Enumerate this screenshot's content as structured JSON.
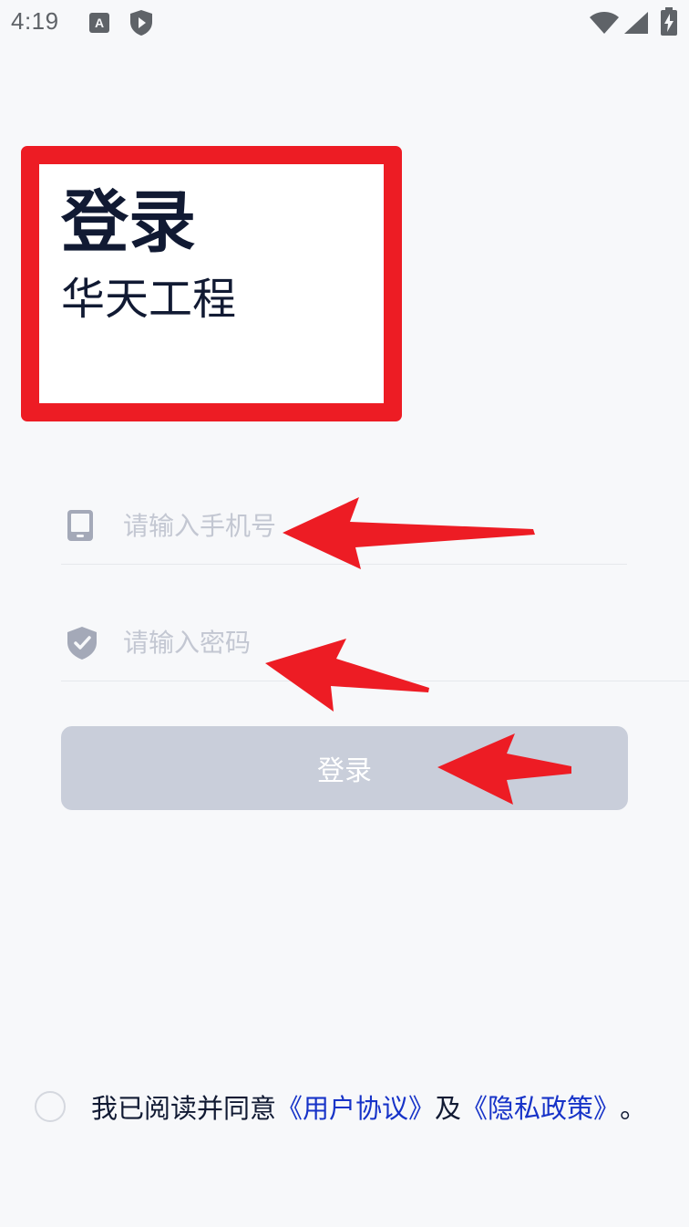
{
  "status_bar": {
    "time": "4:19",
    "a_badge": "A",
    "icons": [
      "a-badge-icon",
      "shield-play-icon",
      "wifi-icon",
      "signal-icon",
      "battery-charging-icon"
    ]
  },
  "header": {
    "title": "登录",
    "subtitle": "华天工程"
  },
  "form": {
    "phone_placeholder": "请输入手机号",
    "phone_value": "",
    "phone_icon": "phone-icon",
    "password_placeholder": "请输入密码",
    "password_value": "",
    "password_icon": "shield-check-icon",
    "login_label": "登录"
  },
  "agreement": {
    "checked": false,
    "text_prefix": "我已阅读并同意",
    "user_agreement": "《用户协议》",
    "conjunction": "及",
    "privacy_policy": "《隐私政策》",
    "text_suffix": "。"
  },
  "colors": {
    "background": "#f7f8fa",
    "annotation_red": "#ed1c24",
    "title_text": "#111a33",
    "placeholder": "#c3c7d2",
    "button_disabled": "#c9ceda",
    "link": "#1733c8",
    "icon_gray": "#a4a9b8"
  }
}
